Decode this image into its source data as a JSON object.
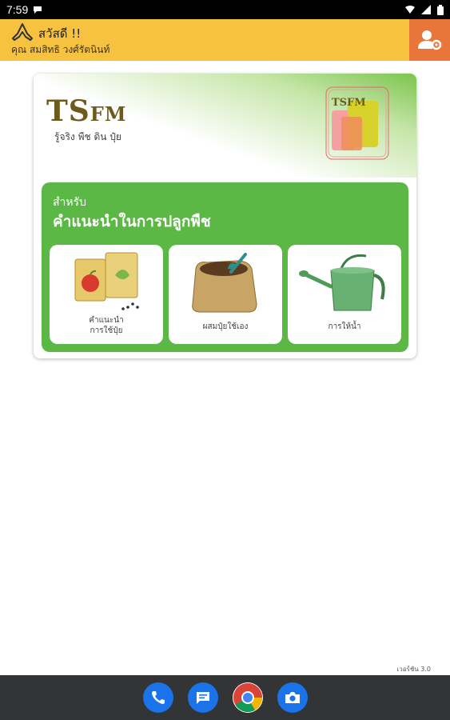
{
  "status_bar": {
    "time": "7:59"
  },
  "header": {
    "greeting": "สวัสดี !!",
    "user_name": "คุณ สมสิทธิ วงศ์รัตนินท์"
  },
  "card": {
    "brand_ts": "TS",
    "brand_fm": "FM",
    "tagline": "รู้จริง พืช ดิน ปุ๋ย",
    "logo_text": "TSFM",
    "section_for": "สำหรับ",
    "section_title": "คำแนะนำในการปลูกพืช",
    "tiles": [
      {
        "label_line1": "คำแนะนำ",
        "label_line2": "การใช้ปุ๋ย",
        "icon": "seed-packets-icon"
      },
      {
        "label_line1": "ผสมปุ๋ยใช้เอง",
        "label_line2": "",
        "icon": "fertilizer-sack-icon"
      },
      {
        "label_line1": "การให้น้ำ",
        "label_line2": "",
        "icon": "watering-can-icon"
      }
    ]
  },
  "version": "เวอร์ชัน 3.0",
  "colors": {
    "header": "#f7c23f",
    "profile_button": "#e8763a",
    "panel_green": "#5cb845",
    "brand_brown": "#6d5a1d"
  },
  "navbar": {
    "apps": [
      "phone-icon",
      "messages-icon",
      "chrome-icon",
      "camera-icon"
    ]
  }
}
